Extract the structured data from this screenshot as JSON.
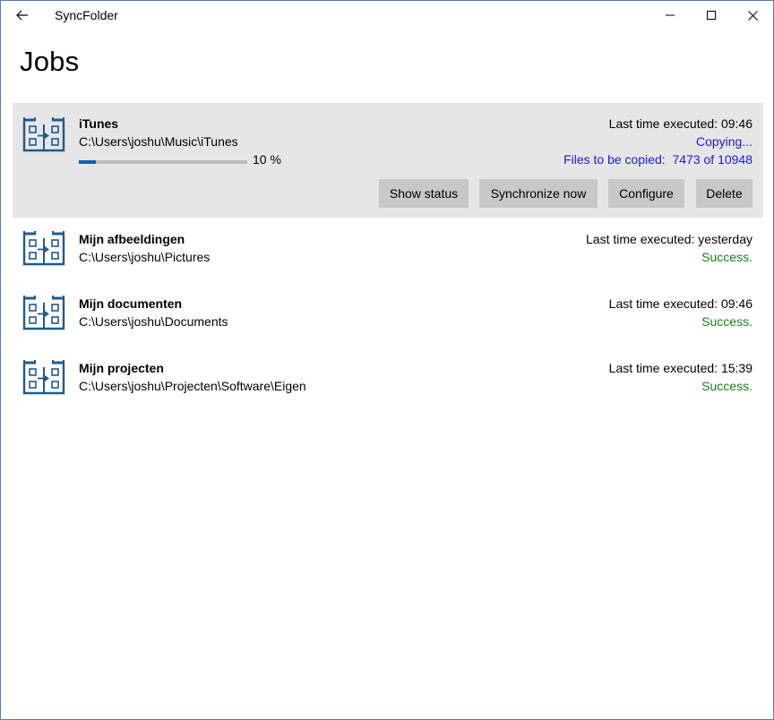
{
  "window": {
    "title": "SyncFolder",
    "back_icon": "back-arrow-icon",
    "controls": [
      "minimize-icon",
      "maximize-icon",
      "close-icon"
    ]
  },
  "page": {
    "title": "Jobs"
  },
  "colors": {
    "selected_bg": "#e6e6e6",
    "success": "#1e7a1e",
    "copying": "#1a1adc",
    "progress": "#1060b0",
    "icon": "#1f5b8c"
  },
  "jobs": [
    {
      "name": "iTunes",
      "path": "C:\\Users\\joshu\\Music\\iTunes",
      "last_executed": "Last time executed: 09:46",
      "status": "Copying...",
      "files_to_copy": "Files to be copied:  7473 of 10948",
      "progress": 0.1,
      "progress_label": "10 %",
      "buttons": {
        "show_status": "Show status",
        "synchronize": "Synchronize now",
        "configure": "Configure",
        "delete": "Delete"
      }
    },
    {
      "name": "Mijn afbeeldingen",
      "path": "C:\\Users\\joshu\\Pictures",
      "last_executed": "Last time executed: yesterday",
      "status": "Success."
    },
    {
      "name": "Mijn documenten",
      "path": "C:\\Users\\joshu\\Documents",
      "last_executed": "Last time executed: 09:46",
      "status": "Success."
    },
    {
      "name": "Mijn projecten",
      "path": "C:\\Users\\joshu\\Projecten\\Software\\Eigen",
      "last_executed": "Last time executed: 15:39",
      "status": "Success."
    }
  ]
}
